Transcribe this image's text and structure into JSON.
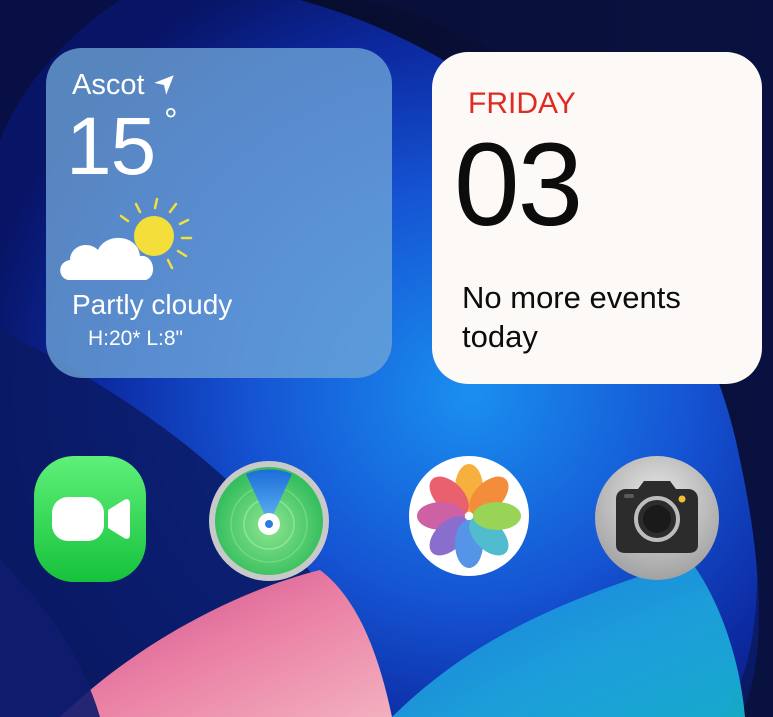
{
  "weather": {
    "city": "Ascot",
    "temperature": "15",
    "degree_symbol": "°",
    "condition": "Partly cloudy",
    "high_low": "H:20* L:8\"",
    "location_icon": "location-arrow-icon",
    "condition_icon": "partly-cloudy-icon"
  },
  "calendar": {
    "day_name": "FRIDAY",
    "date_number": "03",
    "events_text": "No more events today"
  },
  "apps": [
    {
      "id": "facetime",
      "icon": "facetime-icon",
      "color": "#2ee04f"
    },
    {
      "id": "find-my",
      "icon": "find-my-icon",
      "color": "#35c46a"
    },
    {
      "id": "photos",
      "icon": "photos-icon",
      "color": "#ffffff"
    },
    {
      "id": "camera",
      "icon": "camera-icon",
      "color": "#c9c9c9"
    }
  ],
  "colors": {
    "day_accent": "#e02b22",
    "calendar_bg": "#fdf9f7",
    "weather_bg": "#6ea5d7"
  }
}
